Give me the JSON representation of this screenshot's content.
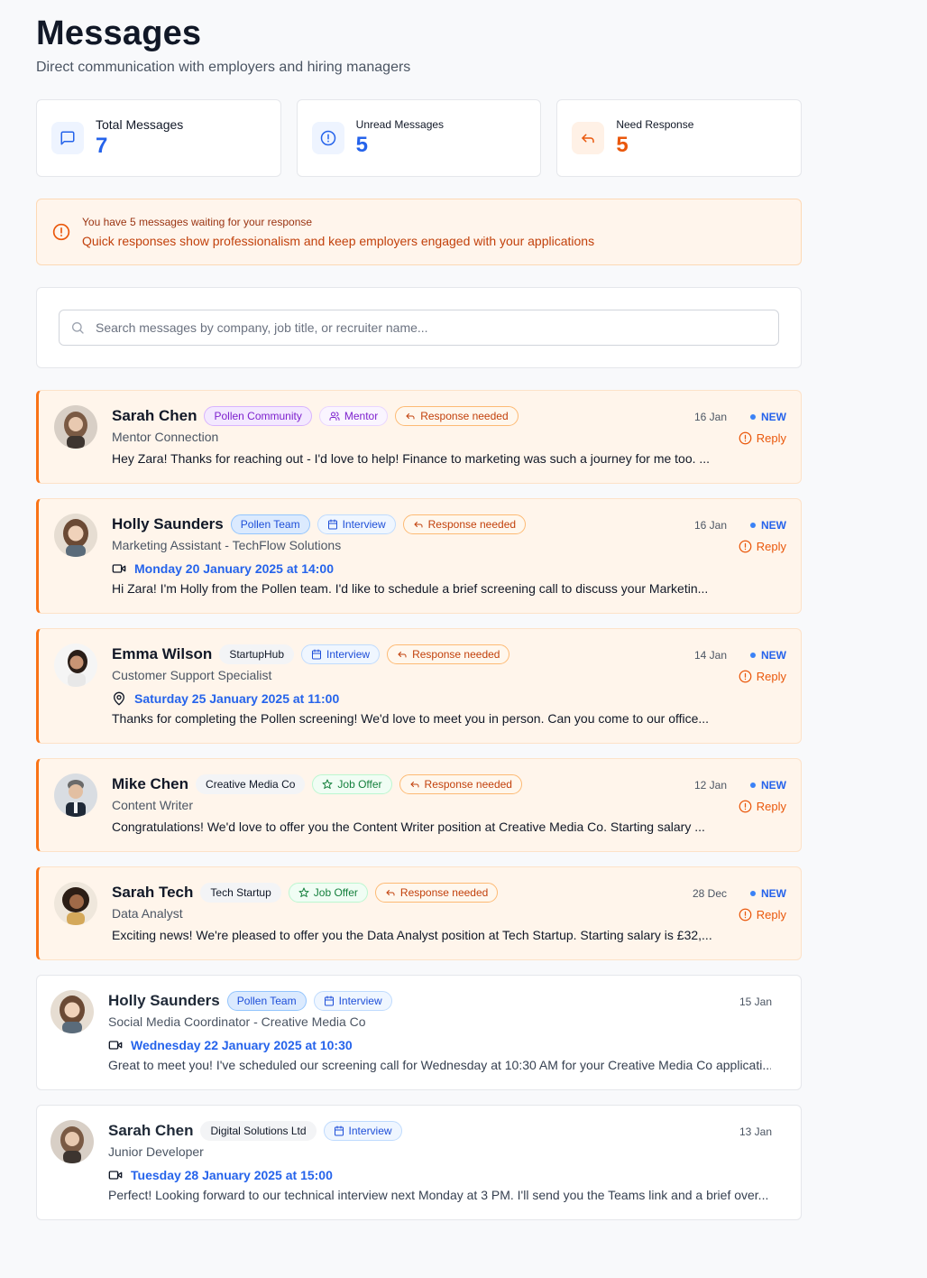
{
  "header": {
    "title": "Messages",
    "subtitle": "Direct communication with employers and hiring managers"
  },
  "stats": [
    {
      "label": "Total Messages",
      "value": "7",
      "icon": "message-square-icon"
    },
    {
      "label": "Unread Messages",
      "value": "5",
      "icon": "alert-circle-icon"
    },
    {
      "label": "Need Response",
      "value": "5",
      "icon": "reply-icon"
    }
  ],
  "alert": {
    "title": "You have 5 messages waiting for your response",
    "text": "Quick responses show professionalism and keep employers engaged with your applications"
  },
  "search": {
    "placeholder": "Search messages by company, job title, or recruiter name..."
  },
  "labels": {
    "new": "NEW",
    "reply": "Reply"
  },
  "colors": {
    "accent_blue": "#2563eb",
    "accent_orange": "#ea580c",
    "unread_bg": "#fff5eb"
  },
  "messages": [
    {
      "name": "Sarah Chen",
      "badges": [
        "Pollen Community",
        "Mentor",
        "Response needed"
      ],
      "subtitle": "Mentor Connection",
      "preview": "Hey Zara! Thanks for reaching out - I'd love to help! Finance to marketing was such a journey for me too. ...",
      "date": "16 Jan"
    },
    {
      "name": "Holly Saunders",
      "badges": [
        "Pollen Team",
        "Interview",
        "Response needed"
      ],
      "subtitle": "Marketing Assistant - TechFlow Solutions",
      "when": "Monday 20 January 2025 at 14:00",
      "preview": "Hi Zara! I'm Holly from the Pollen team. I'd like to schedule a brief screening call to discuss your Marketin...",
      "date": "16 Jan"
    },
    {
      "name": "Emma Wilson",
      "badges": [
        "StartupHub",
        "Interview",
        "Response needed"
      ],
      "subtitle": "Customer Support Specialist",
      "when": "Saturday 25 January 2025 at 11:00",
      "preview": "Thanks for completing the Pollen screening! We'd love to meet you in person. Can you come to our office...",
      "date": "14 Jan"
    },
    {
      "name": "Mike Chen",
      "badges": [
        "Creative Media Co",
        "Job Offer",
        "Response needed"
      ],
      "subtitle": "Content Writer",
      "preview": "Congratulations! We'd love to offer you the Content Writer position at Creative Media Co. Starting salary ...",
      "date": "12 Jan"
    },
    {
      "name": "Sarah Tech",
      "badges": [
        "Tech Startup",
        "Job Offer",
        "Response needed"
      ],
      "subtitle": "Data Analyst",
      "preview": "Exciting news! We're pleased to offer you the Data Analyst position at Tech Startup. Starting salary is £32,...",
      "date": "28 Dec"
    },
    {
      "name": "Holly Saunders",
      "badges": [
        "Pollen Team",
        "Interview"
      ],
      "subtitle": "Social Media Coordinator - Creative Media Co",
      "when": "Wednesday 22 January 2025 at 10:30",
      "preview": "Great to meet you! I've scheduled our screening call for Wednesday at 10:30 AM for your Creative Media Co applicati...",
      "date": "15 Jan"
    },
    {
      "name": "Sarah Chen",
      "badges": [
        "Digital Solutions Ltd",
        "Interview"
      ],
      "subtitle": "Junior Developer",
      "when": "Tuesday 28 January 2025 at 15:00",
      "preview": "Perfect! Looking forward to our technical interview next Monday at 3 PM. I'll send you the Teams link and a brief over...",
      "date": "13 Jan"
    }
  ]
}
